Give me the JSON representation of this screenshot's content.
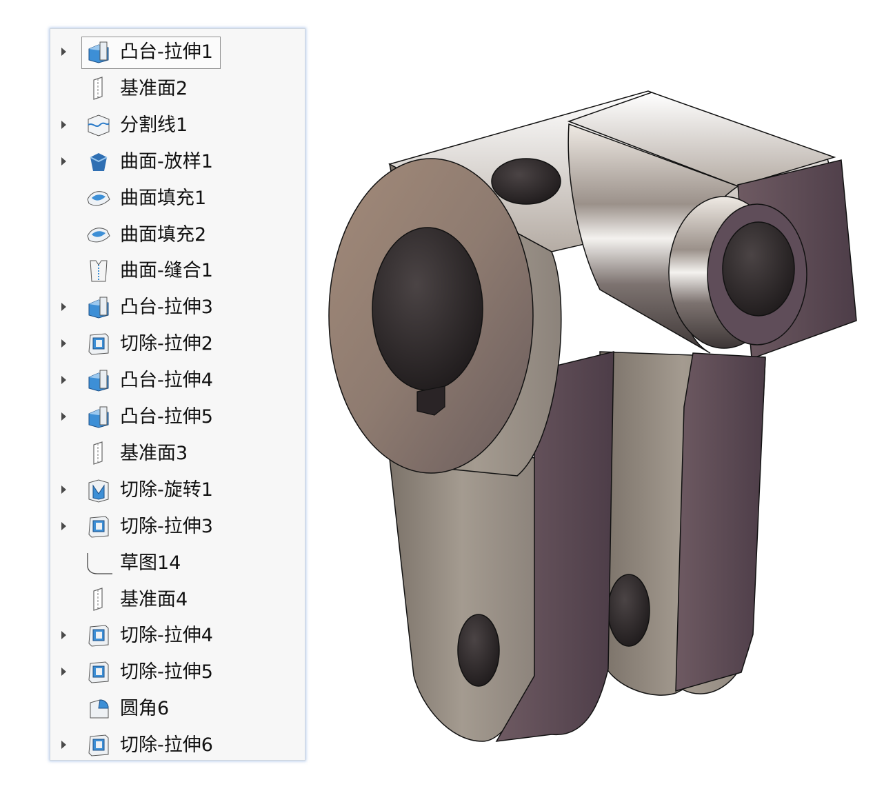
{
  "feature_tree": {
    "items": [
      {
        "label": "凸台-拉伸1",
        "icon": "boss-extrude-icon",
        "expandable": true,
        "selected": true
      },
      {
        "label": "基准面2",
        "icon": "reference-plane-icon",
        "expandable": false
      },
      {
        "label": "分割线1",
        "icon": "split-line-icon",
        "expandable": true
      },
      {
        "label": "曲面-放样1",
        "icon": "surface-loft-icon",
        "expandable": true
      },
      {
        "label": "曲面填充1",
        "icon": "surface-fill-icon",
        "expandable": false
      },
      {
        "label": "曲面填充2",
        "icon": "surface-fill-icon",
        "expandable": false
      },
      {
        "label": "曲面-缝合1",
        "icon": "surface-knit-icon",
        "expandable": false
      },
      {
        "label": "凸台-拉伸3",
        "icon": "boss-extrude-icon",
        "expandable": true
      },
      {
        "label": "切除-拉伸2",
        "icon": "cut-extrude-icon",
        "expandable": true
      },
      {
        "label": "凸台-拉伸4",
        "icon": "boss-extrude-icon",
        "expandable": true
      },
      {
        "label": "凸台-拉伸5",
        "icon": "boss-extrude-icon",
        "expandable": true
      },
      {
        "label": "基准面3",
        "icon": "reference-plane-icon",
        "expandable": false
      },
      {
        "label": "切除-旋转1",
        "icon": "cut-revolve-icon",
        "expandable": true
      },
      {
        "label": "切除-拉伸3",
        "icon": "cut-extrude-icon",
        "expandable": true
      },
      {
        "label": "草图14",
        "icon": "sketch-icon",
        "expandable": false
      },
      {
        "label": "基准面4",
        "icon": "reference-plane-icon",
        "expandable": false
      },
      {
        "label": "切除-拉伸4",
        "icon": "cut-extrude-icon",
        "expandable": true
      },
      {
        "label": "切除-拉伸5",
        "icon": "cut-extrude-icon",
        "expandable": true
      },
      {
        "label": "圆角6",
        "icon": "fillet-icon",
        "expandable": false
      },
      {
        "label": "切除-拉伸6",
        "icon": "cut-extrude-icon",
        "expandable": true
      }
    ]
  },
  "colors": {
    "panel_bg": "#f7f7f7",
    "icon_blue": "#3d8fd6",
    "part_face": "#8b7768",
    "part_side": "#5b4a55"
  }
}
